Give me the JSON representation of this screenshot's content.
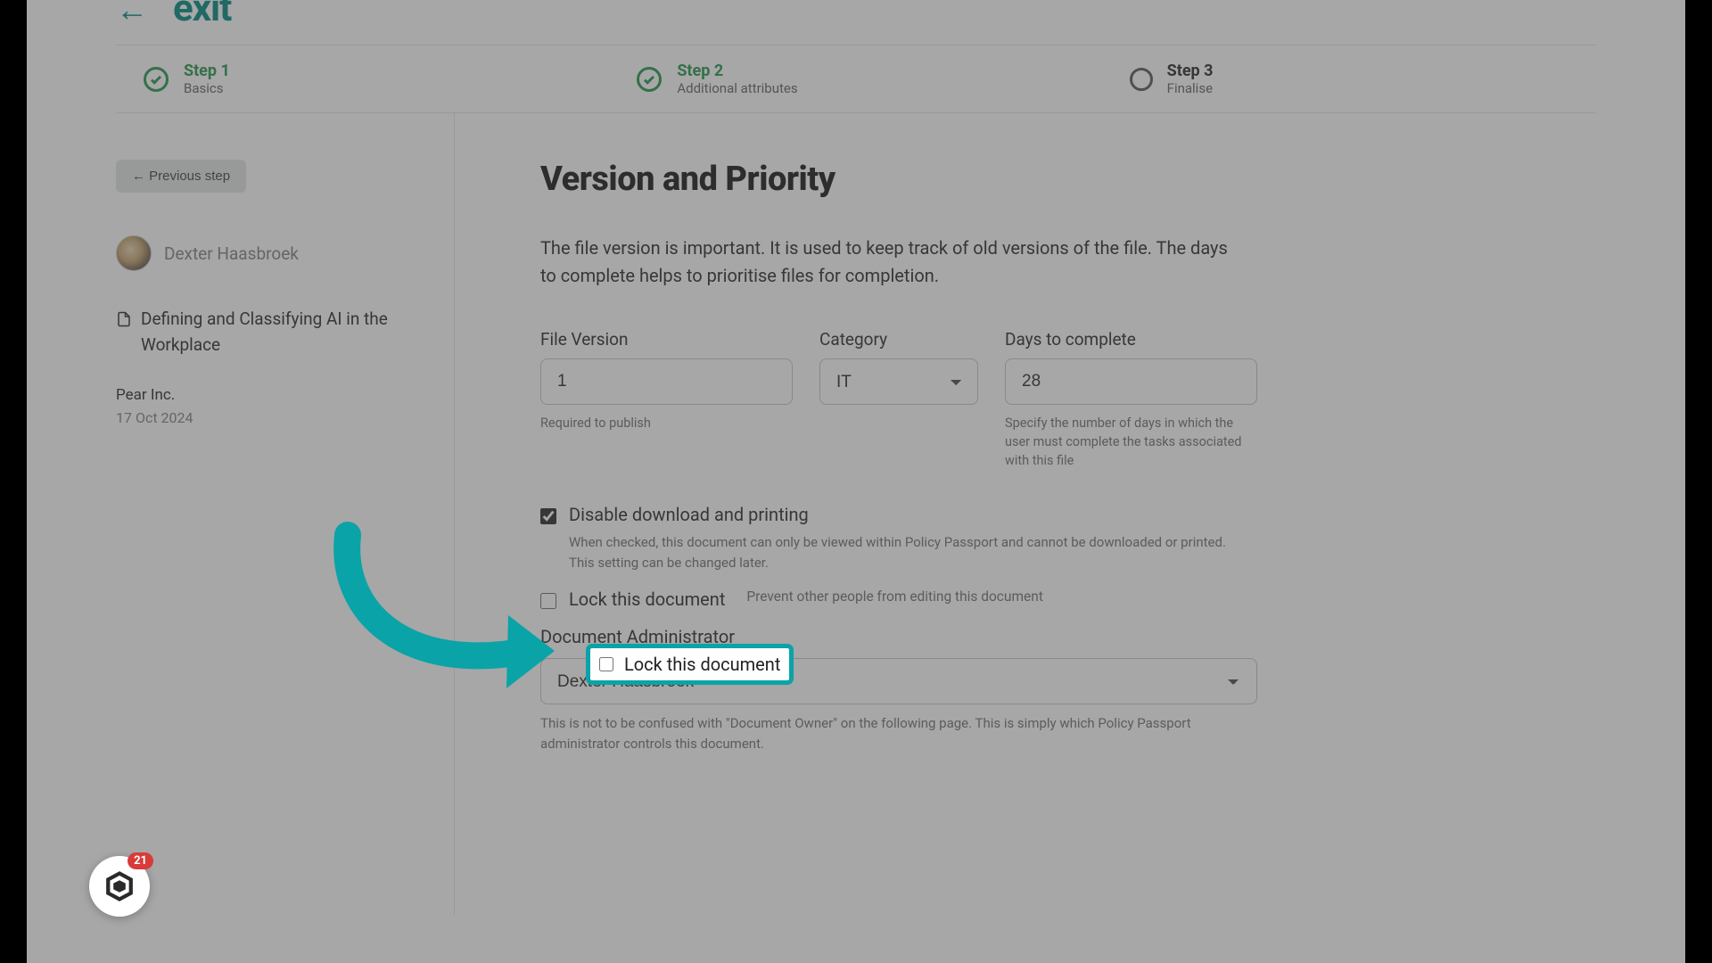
{
  "topbar": {
    "back_glyph": "←",
    "exit_label": "exit"
  },
  "steps": [
    {
      "title": "Step 1",
      "sub": "Basics",
      "state": "done"
    },
    {
      "title": "Step 2",
      "sub": "Additional attributes",
      "state": "done"
    },
    {
      "title": "Step 3",
      "sub": "Finalise",
      "state": "pending"
    }
  ],
  "sidebar": {
    "prev_label": "←  Previous step",
    "user_name": "Dexter Haasbroek",
    "doc_title": "Defining and Classifying AI in the Workplace",
    "org": "Pear Inc.",
    "date": "17 Oct 2024"
  },
  "main": {
    "heading": "Version and Priority",
    "intro": "The file version is important. It is used to keep track of old versions of the file. The days to complete helps to prioritise files for completion.",
    "file_version": {
      "label": "File Version",
      "value": "1",
      "helper": "Required to publish"
    },
    "category": {
      "label": "Category",
      "value": "IT"
    },
    "days": {
      "label": "Days to complete",
      "value": "28",
      "helper": "Specify the number of days in which the user must complete the tasks associated with this file"
    },
    "disable_dl": {
      "label": "Disable download and printing",
      "checked": true,
      "helper": "When checked, this document can only be viewed within Policy Passport and cannot be downloaded or printed. This setting can be changed later."
    },
    "lock": {
      "label": "Lock this document",
      "checked": false,
      "inline_help": "Prevent other people from editing this document"
    },
    "admin": {
      "label": "Document Administrator",
      "value": "Dexter Haasbroek",
      "helper": "This is not to be confused with \"Document Owner\" on the following page. This is simply which Policy Passport administrator controls this document."
    }
  },
  "chat": {
    "badge": "21"
  }
}
